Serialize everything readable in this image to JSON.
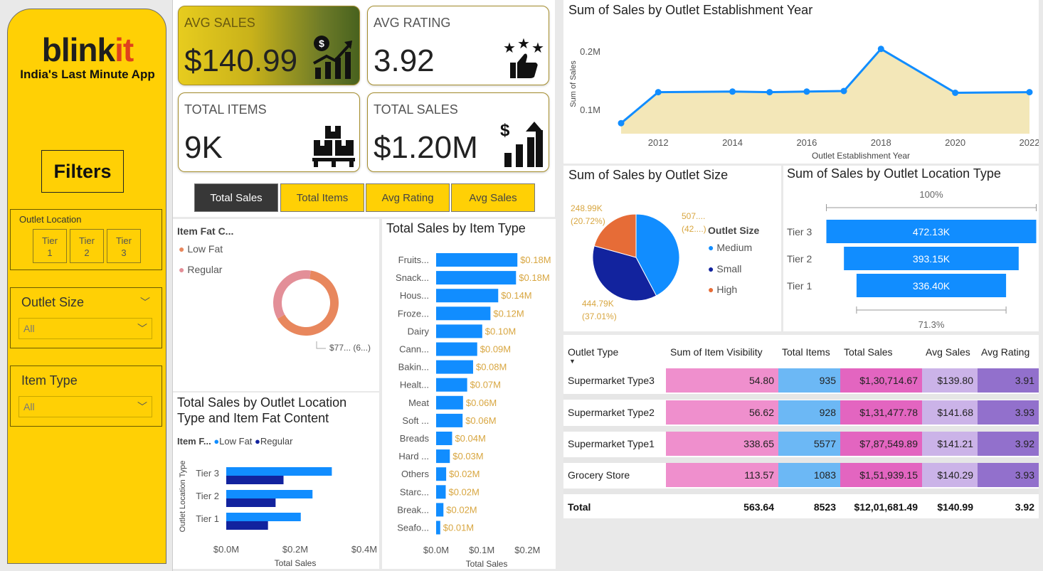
{
  "brand": {
    "name_prefix": "blink",
    "name_suffix": "it",
    "tagline": "India's Last Minute App"
  },
  "filters": {
    "title": "Filters",
    "outlet_location": {
      "title": "Outlet Location",
      "tiers": [
        "Tier\n1",
        "Tier\n2",
        "Tier\n3"
      ]
    },
    "outlet_size": {
      "title": "Outlet Size",
      "value": "All"
    },
    "item_type": {
      "title": "Item Type",
      "value": "All"
    }
  },
  "kpis": {
    "avg_sales": {
      "label": "AVG SALES",
      "value": "$140.99",
      "icon": "dollar-growth-icon"
    },
    "avg_rating": {
      "label": "AVG RATING",
      "value": "3.92",
      "icon": "stars-thumbs-up-icon"
    },
    "total_items": {
      "label": "TOTAL ITEMS",
      "value": "9K",
      "icon": "boxes-pallet-icon"
    },
    "total_sales": {
      "label": "TOTAL SALES",
      "value": "$1.20M",
      "icon": "dollar-bars-icon"
    }
  },
  "nav_buttons": [
    "Total Sales",
    "Total Items",
    "Avg Rating",
    "Avg Sales"
  ],
  "colors": {
    "accent": "#ffd005",
    "blue": "#118dff",
    "navy": "#12239e",
    "orange": "#e66c37",
    "pink_row": "#ef8fcd",
    "light_blue": "#6cb8f5",
    "magenta": "#e365c0",
    "lavender": "#cbb3e8",
    "purple": "#9270cc"
  },
  "chart_data": [
    {
      "type": "area",
      "title": "Sum of Sales by Outlet Establishment Year",
      "xlabel": "Outlet Establishment Year",
      "ylabel": "Sum of Sales",
      "x": [
        2011,
        2012,
        2014,
        2015,
        2016,
        2017,
        2018,
        2020,
        2022
      ],
      "values": [
        0.078,
        0.131,
        0.132,
        0.131,
        0.132,
        0.133,
        0.205,
        0.13,
        0.131
      ],
      "x_ticks": [
        "2012",
        "2014",
        "2016",
        "2018",
        "2020",
        "2022"
      ],
      "y_ticks": [
        "0.1M",
        "0.2M"
      ],
      "ylim": [
        0.06,
        0.24
      ]
    },
    {
      "type": "pie",
      "title": "Sum of Sales by Outlet Size",
      "legend_title": "Outlet Size",
      "series": [
        {
          "name": "Medium",
          "value": 507.9,
          "label_top": "507....",
          "label_bot": "(42....)"
        },
        {
          "name": "Small",
          "value": 444.79,
          "label_top": "444.79K",
          "label_bot": "(37.01%)"
        },
        {
          "name": "High",
          "value": 248.99,
          "label_top": "248.99K",
          "label_bot": "(20.72%)"
        }
      ]
    },
    {
      "type": "bar",
      "title": "Sum of Sales by Outlet Location Type",
      "categories": [
        "Tier 3",
        "Tier 2",
        "Tier 1"
      ],
      "values": [
        472.13,
        393.15,
        336.4
      ],
      "labels": [
        "472.13K",
        "393.15K",
        "336.40K"
      ],
      "top_pct": "100%",
      "bottom_pct": "71.3%"
    },
    {
      "type": "pie",
      "title": "Item Fat C...",
      "legend": [
        "Low Fat",
        "Regular"
      ],
      "values": [
        776.3,
        425.4
      ],
      "slice_label": "$77... (6...)"
    },
    {
      "type": "bar",
      "title": "Total Sales by Item Type",
      "xlabel": "Total Sales",
      "categories": [
        "Fruits...",
        "Snack...",
        "Hous...",
        "Froze...",
        "Dairy",
        "Cann...",
        "Bakin...",
        "Healt...",
        "Meat",
        "Soft ...",
        "Breads",
        "Hard ...",
        "Others",
        "Starc...",
        "Break...",
        "Seafo..."
      ],
      "values": [
        0.178,
        0.175,
        0.136,
        0.119,
        0.101,
        0.09,
        0.081,
        0.068,
        0.059,
        0.058,
        0.035,
        0.03,
        0.022,
        0.021,
        0.016,
        0.009
      ],
      "labels": [
        "$0.18M",
        "$0.18M",
        "$0.14M",
        "$0.12M",
        "$0.10M",
        "$0.09M",
        "$0.08M",
        "$0.07M",
        "$0.06M",
        "$0.06M",
        "$0.04M",
        "$0.03M",
        "$0.02M",
        "$0.02M",
        "$0.02M",
        "$0.01M"
      ],
      "x_ticks": [
        "$0.0M",
        "$0.1M",
        "$0.2M"
      ],
      "xlim": [
        0,
        0.24
      ]
    },
    {
      "type": "bar",
      "title": "Total Sales by Outlet Location Type and Item Fat Content",
      "legend_title": "Item F...",
      "legend": [
        "Low Fat",
        "Regular"
      ],
      "ylabel": "Outlet Location Type",
      "xlabel": "Total Sales",
      "categories": [
        "Tier 3",
        "Tier 2",
        "Tier 1"
      ],
      "series": [
        {
          "name": "Low Fat",
          "values": [
            0.306,
            0.25,
            0.216
          ]
        },
        {
          "name": "Regular",
          "values": [
            0.166,
            0.143,
            0.121
          ]
        }
      ],
      "x_ticks": [
        "$0.0M",
        "$0.2M",
        "$0.4M"
      ],
      "xlim": [
        0,
        0.4
      ]
    },
    {
      "type": "table",
      "columns": [
        "Outlet Type",
        "Sum of Item Visibility",
        "Total Items",
        "Total Sales",
        "Avg Sales",
        "Avg Rating"
      ],
      "rows": [
        [
          "Supermarket Type3",
          "54.80",
          "935",
          "$1,30,714.67",
          "$139.80",
          "3.91"
        ],
        [
          "Supermarket Type2",
          "56.62",
          "928",
          "$1,31,477.78",
          "$141.68",
          "3.93"
        ],
        [
          "Supermarket Type1",
          "338.65",
          "5577",
          "$7,87,549.89",
          "$141.21",
          "3.92"
        ],
        [
          "Grocery Store",
          "113.57",
          "1083",
          "$1,51,939.15",
          "$140.29",
          "3.93"
        ]
      ],
      "total": [
        "Total",
        "563.64",
        "8523",
        "$12,01,681.49",
        "$140.99",
        "3.92"
      ]
    }
  ]
}
